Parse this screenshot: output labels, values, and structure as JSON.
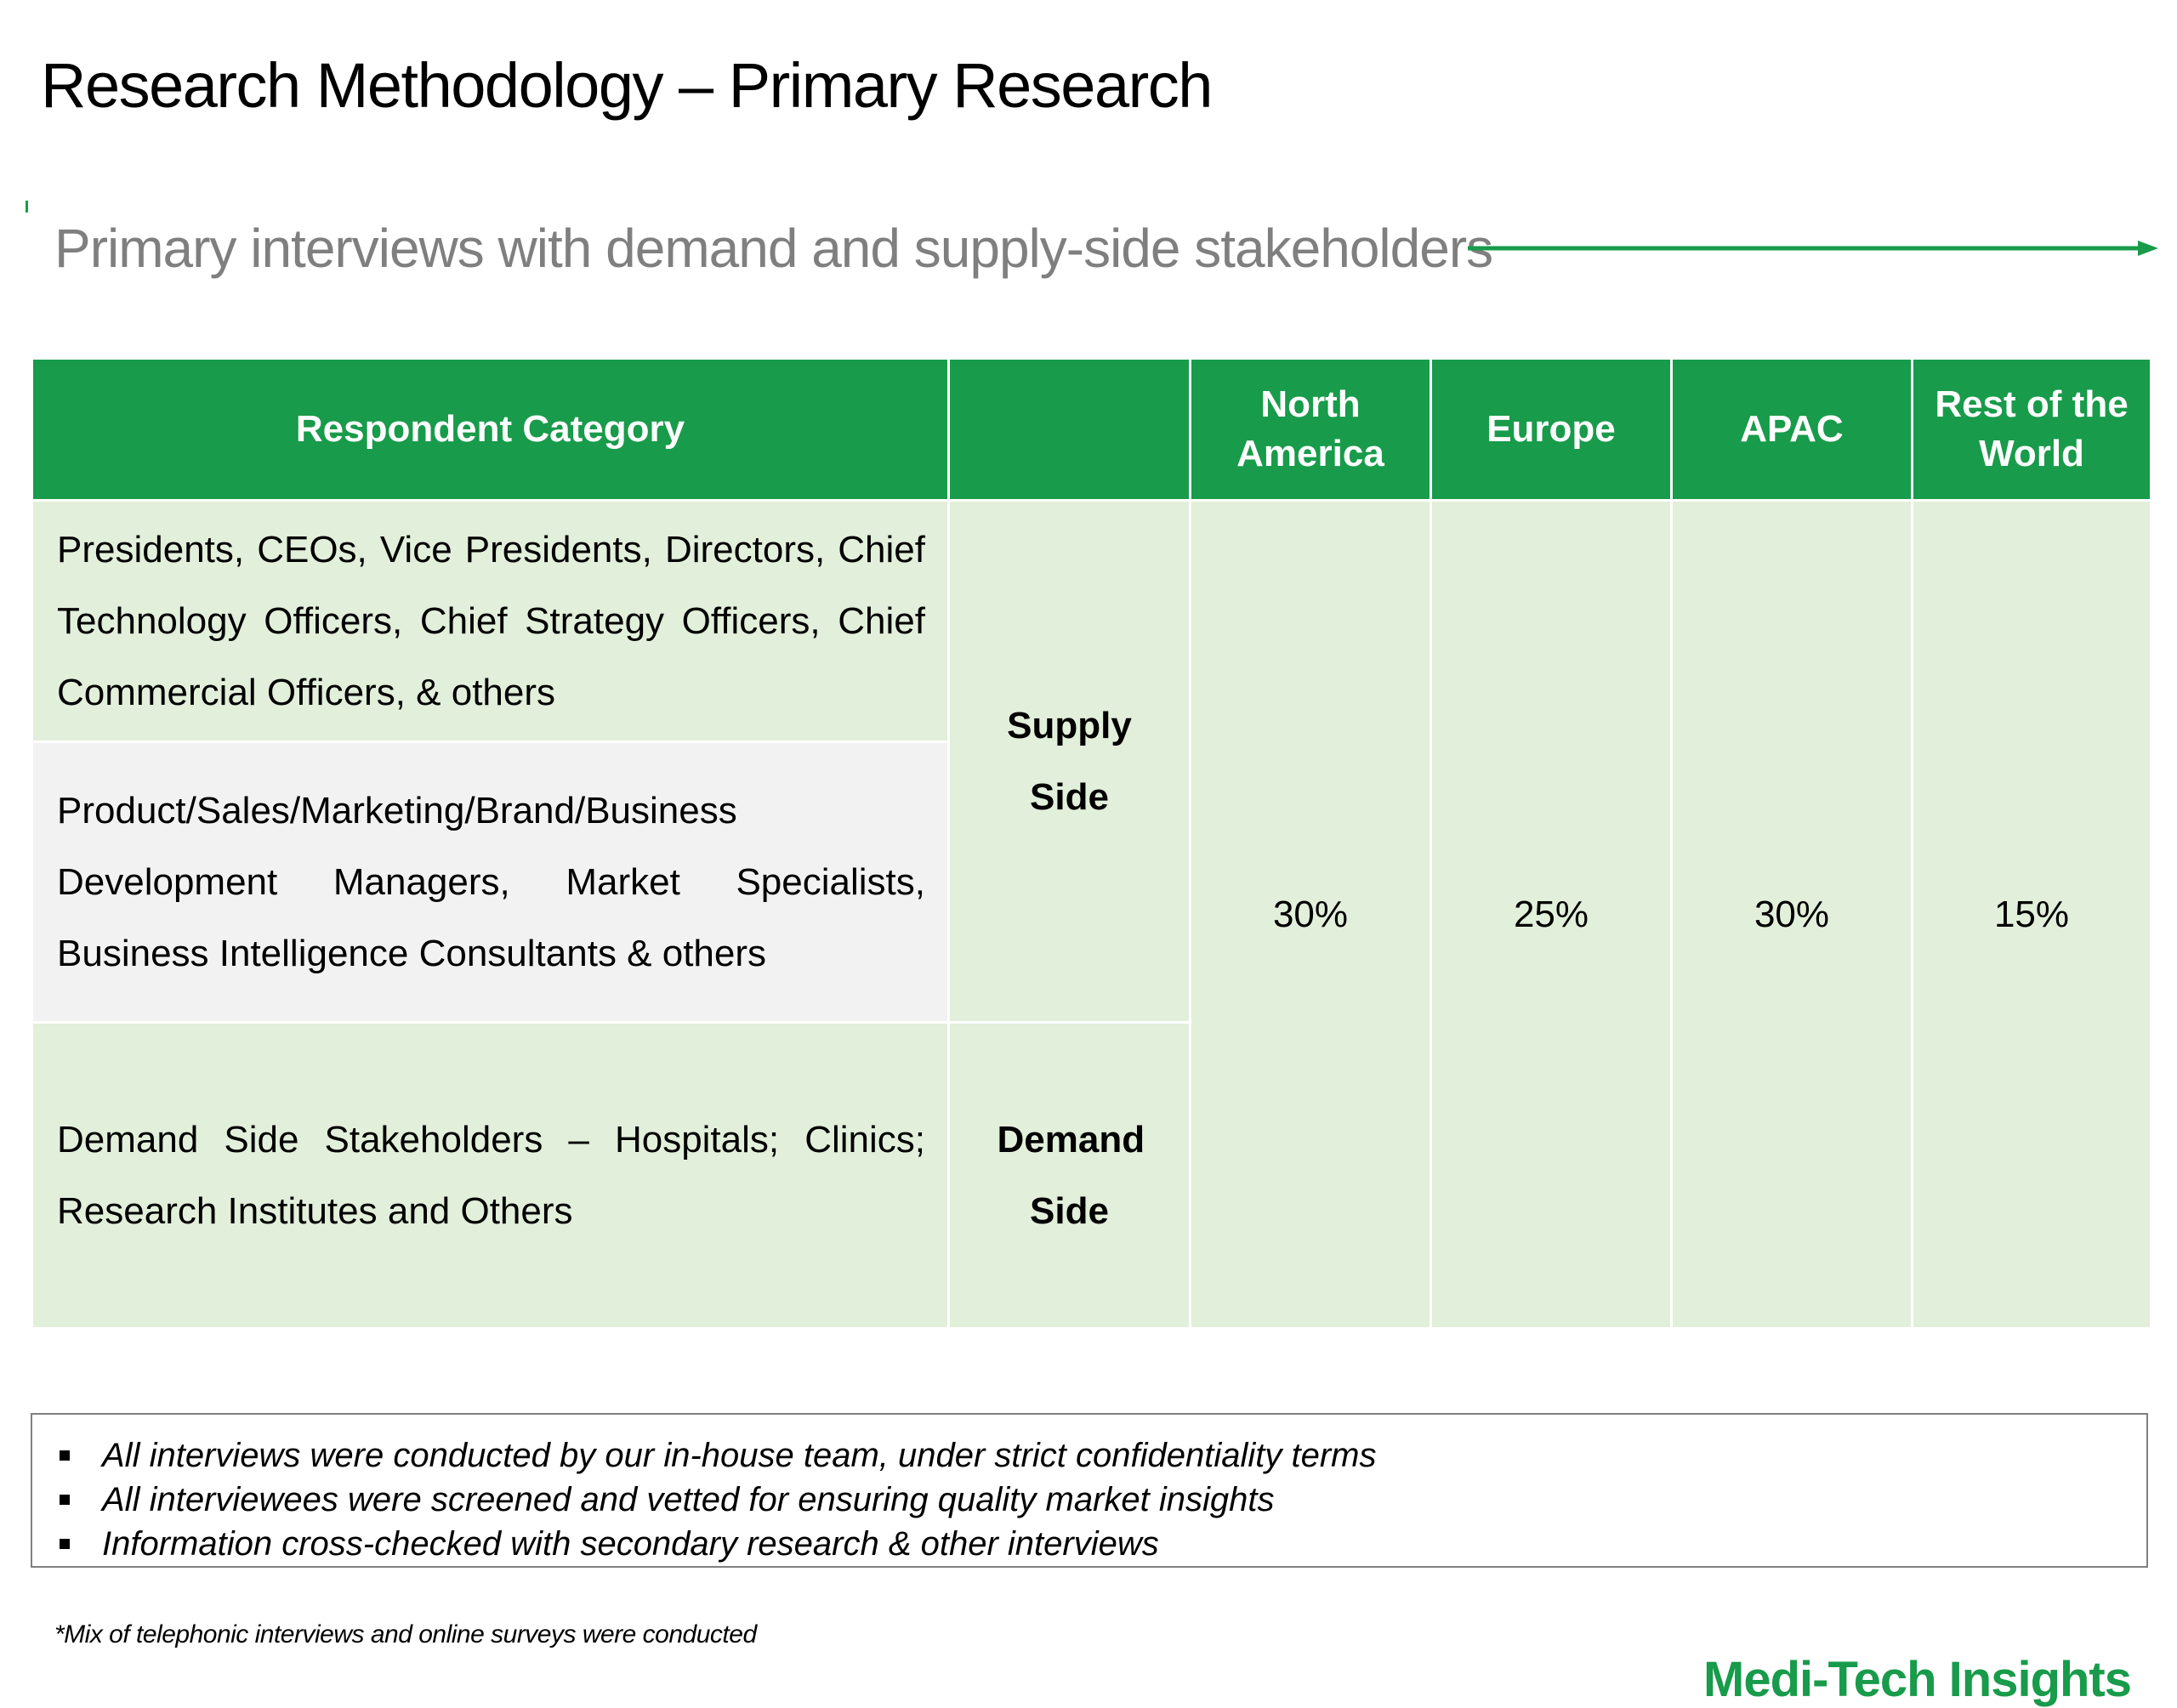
{
  "page": {
    "title": "Research Methodology – Primary Research",
    "subtitle": "Primary interviews with demand and supply-side stakeholders"
  },
  "colors": {
    "accent": "#189b4a",
    "row_green": "#e2efda",
    "row_grey": "#f2f2f2",
    "subtitle_grey": "#7f7f7f"
  },
  "table": {
    "headers": {
      "category": "Respondent Category",
      "side": "",
      "regions": [
        "North America",
        "Europe",
        "APAC",
        "Rest of the World"
      ]
    },
    "rows": [
      "Presidents, CEOs, Vice Presidents, Directors, Chief Technology Officers, Chief Strategy Officers, Chief Commercial Officers, & others",
      "Product/Sales/Marketing/Brand/Business Development Managers, Market Specialists, Business Intelligence Consultants & others",
      "Demand Side Stakeholders – Hospitals; Clinics; Research Institutes and Others"
    ],
    "sides": {
      "supply": "Supply Side",
      "demand": "Demand Side"
    },
    "shares": [
      "30%",
      "25%",
      "30%",
      "15%"
    ]
  },
  "notes": [
    "All interviews were conducted by our in-house team, under strict confidentiality terms",
    "All interviewees were screened and vetted for ensuring quality market insights",
    "Information cross-checked with secondary research & other interviews"
  ],
  "footnote": "*Mix of telephonic interviews and online surveys were conducted",
  "brand": "Medi-Tech Insights"
}
